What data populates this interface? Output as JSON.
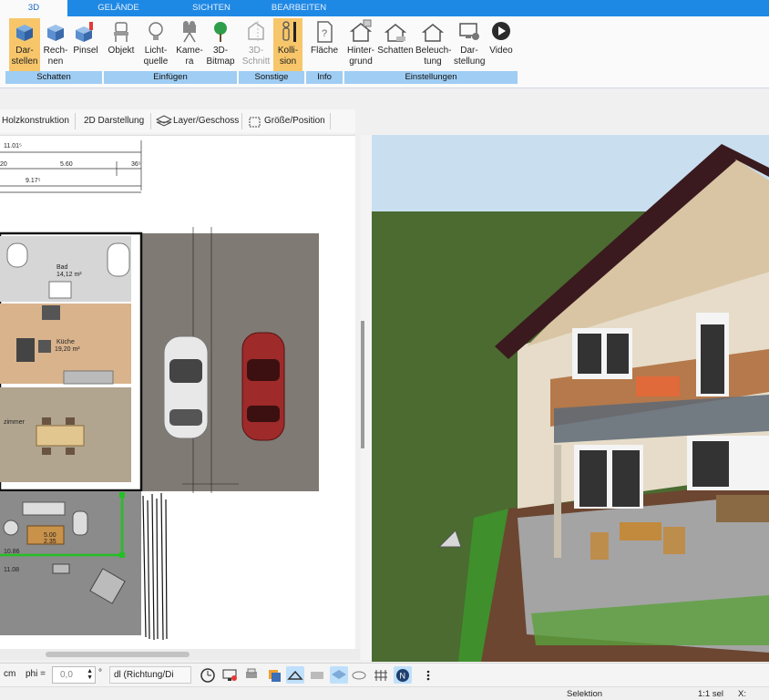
{
  "tabs": [
    {
      "label": "3D",
      "active": true
    },
    {
      "label": "GELÄNDE"
    },
    {
      "label": "SICHTEN"
    },
    {
      "label": "BEARBEITEN"
    }
  ],
  "ribbon": {
    "buttons": {
      "darstellen": "Dar-\nstellen",
      "rechnen": "Rech-\nnen",
      "pinsel": "Pinsel",
      "objekt": "Objekt",
      "lichtquelle": "Licht-\nquelle",
      "kamera": "Kame-\nra",
      "bitmap": "3D-\nBitmap",
      "schnitt": "3D-\nSchnitt",
      "kollision": "Kolli-\nsion",
      "flaeche": "Fläche",
      "hintergrund": "Hinter-\ngrund",
      "schatten": "Schatten",
      "beleuchtung": "Beleuch-\ntung",
      "darstellung": "Dar-\nstellung",
      "video": "Video"
    },
    "groups": {
      "schatten": "Schatten",
      "einfuegen": "Einfügen",
      "sonstige": "Sonstige",
      "info": "Info",
      "einstellungen": "Einstellungen"
    }
  },
  "toolbar": {
    "holz": "Holzkonstruktion",
    "darstellung2d": "2D Darstellung",
    "layer": "Layer/Geschoss",
    "groesse": "Größe/Position"
  },
  "plan": {
    "dims": {
      "d1": "11.01⁵",
      "d2": "5.60",
      "d3": "36⁵",
      "d4": "9.17⁵",
      "d5": "20",
      "d6": "11.08",
      "d7": "10.86"
    },
    "rooms": {
      "bad": {
        "name": "Bad",
        "area": "14,12 m²"
      },
      "kueche": {
        "name": "Küche",
        "area": "19,20 m²"
      },
      "zimmer": {
        "name": "zimmer"
      },
      "wohn": {
        "label": "5.00",
        "sub": "2.35"
      }
    }
  },
  "statusrow": {
    "unit": "cm",
    "phi_label": "phi =",
    "phi_value": "0,0",
    "deg": "°",
    "dl_value": "dl (Richtung/Di"
  },
  "statusbar": {
    "selektion": "Selektion",
    "scale": "1:1 sel",
    "x": "X:"
  },
  "colors": {
    "accent": "#1e88e5",
    "ribbon_group": "#9fcdf3",
    "active_btn": "#f7c66a",
    "grass": "#4b6b31",
    "sky": "#c9dff0"
  }
}
